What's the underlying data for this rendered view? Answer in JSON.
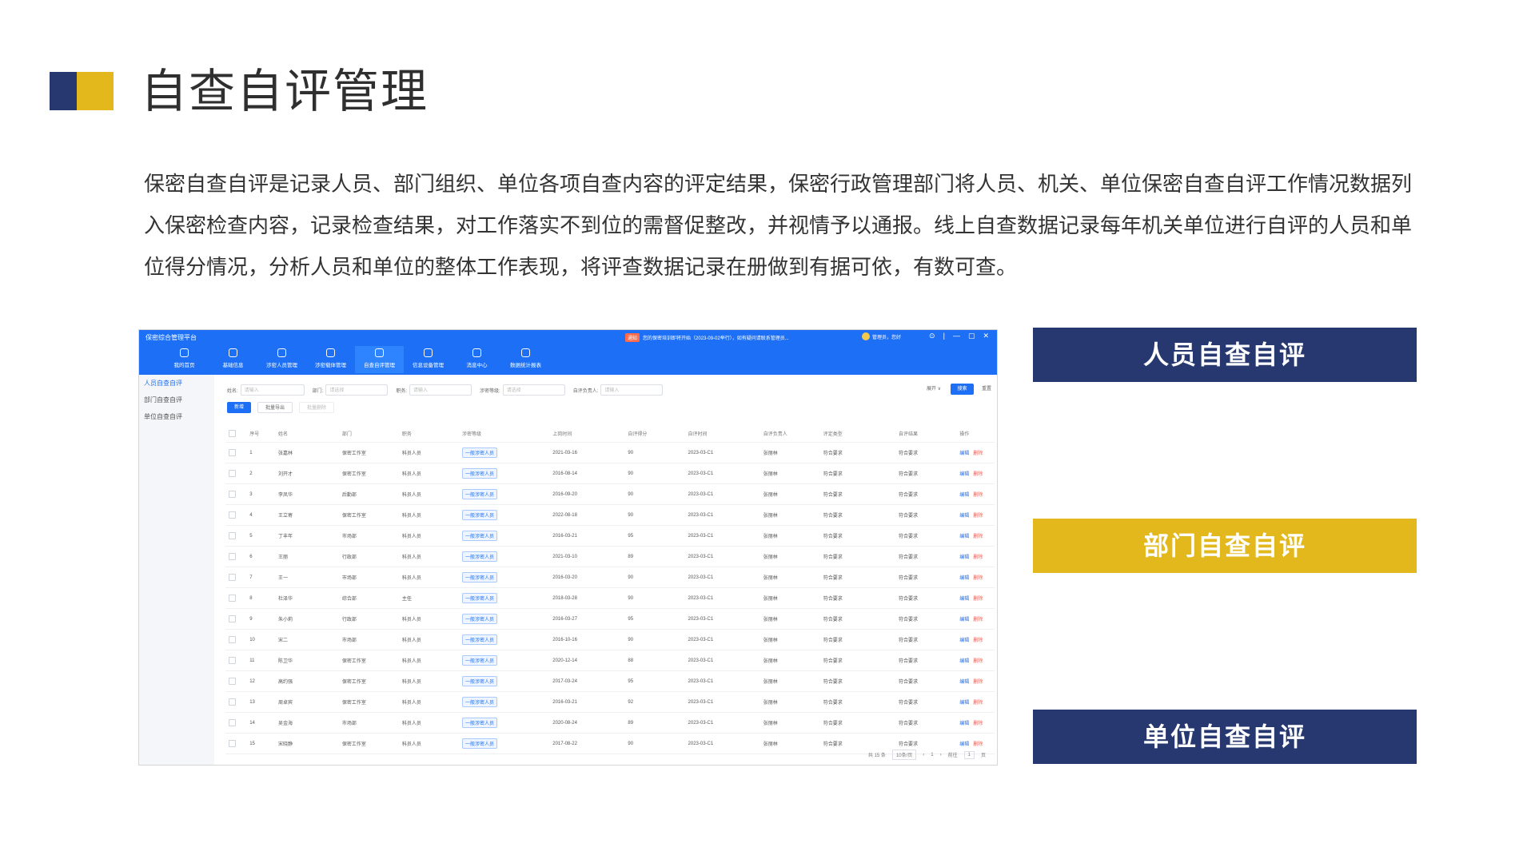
{
  "slide": {
    "title": "自查自评管理",
    "description": "保密自查自评是记录人员、部门组织、单位各项自查内容的评定结果，保密行政管理部门将人员、机关、单位保密自查自评工作情况数据列入保密检查内容，记录检查结果，对工作落实不到位的需督促整改，并视情予以通报。线上自查数据记录每年机关单位进行自评的人员和单位得分情况，分析人员和单位的整体工作表现，将评查数据记录在册做到有据可依，有数可查。",
    "colors": {
      "navy": "#26386f",
      "yellow": "#e2b81c",
      "app_blue": "#1d70f5"
    }
  },
  "app": {
    "brand": "保密综合管理平台",
    "notice_tag": "通知",
    "notice_text": "您的保密培训即将开始（2023-09-02举行），如有疑问请联系管理员...",
    "user": "管理员，您好",
    "window_controls": [
      "⊙",
      "|",
      "—",
      "▢",
      "✕"
    ],
    "nav": [
      {
        "label": "我的首页",
        "icon": "monitor-icon"
      },
      {
        "label": "基础信息",
        "icon": "info-icon"
      },
      {
        "label": "涉密人员管理",
        "icon": "person-icon"
      },
      {
        "label": "涉密载体管理",
        "icon": "archive-icon"
      },
      {
        "label": "自查自评管理",
        "icon": "edit-icon"
      },
      {
        "label": "信息设备管理",
        "icon": "device-icon"
      },
      {
        "label": "消息中心",
        "icon": "chat-icon"
      },
      {
        "label": "数据统计报表",
        "icon": "bar-chart-icon"
      }
    ],
    "sidebar": [
      "人员自查自评",
      "部门自查自评",
      "单位自查自评"
    ],
    "filters": [
      {
        "label": "姓名:",
        "placeholder": "请输入"
      },
      {
        "label": "部门:",
        "placeholder": "请选择"
      },
      {
        "label": "职务:",
        "placeholder": "请输入"
      },
      {
        "label": "涉密等级:",
        "placeholder": "请选择"
      },
      {
        "label": "自评负责人:",
        "placeholder": "请输入"
      }
    ],
    "expand_label": "展开 ∨",
    "search_label": "搜索",
    "reset_label": "重置",
    "actions": [
      "新增",
      "批量导出",
      "批量删除"
    ],
    "columns": [
      "序号",
      "姓名",
      "部门",
      "职务",
      "涉密等级",
      "上岗时间",
      "自评得分",
      "自评时间",
      "自评负责人",
      "评定类型",
      "自评结果",
      "操作"
    ],
    "rows": [
      [
        "1",
        "张嘉林",
        "保密工作室",
        "科员人员",
        "一般涉密人员",
        "2021-03-16",
        "90",
        "2023-03-C1",
        "张丽林",
        "符合要求",
        "符合要求"
      ],
      [
        "2",
        "刘开才",
        "保密工作室",
        "科员人员",
        "一般涉密人员",
        "2016-08-14",
        "90",
        "2023-03-C1",
        "张丽林",
        "符合要求",
        "符合要求"
      ],
      [
        "3",
        "李凤华",
        "后勤部",
        "科员人员",
        "一般涉密人员",
        "2016-09-20",
        "90",
        "2023-03-C1",
        "张丽林",
        "符合要求",
        "符合要求"
      ],
      [
        "4",
        "王立寄",
        "保密工作室",
        "科员人员",
        "一般涉密人员",
        "2022-08-18",
        "90",
        "2023-03-C1",
        "张丽林",
        "符合要求",
        "符合要求"
      ],
      [
        "5",
        "丁丰年",
        "市场部",
        "科员人员",
        "一般涉密人员",
        "2016-03-21",
        "95",
        "2023-03-C1",
        "张丽林",
        "符合要求",
        "符合要求"
      ],
      [
        "6",
        "王丽",
        "行政部",
        "科员人员",
        "一般涉密人员",
        "2021-03-10",
        "89",
        "2023-03-C1",
        "张丽林",
        "符合要求",
        "符合要求"
      ],
      [
        "7",
        "王一",
        "市场部",
        "科员人员",
        "一般涉密人员",
        "2016-03-20",
        "90",
        "2023-03-C1",
        "张丽林",
        "符合要求",
        "符合要求"
      ],
      [
        "8",
        "杜泽华",
        "综合部",
        "主任",
        "一般涉密人员",
        "2018-03-28",
        "90",
        "2023-03-C1",
        "张丽林",
        "符合要求",
        "符合要求"
      ],
      [
        "9",
        "朱小莉",
        "行政部",
        "科员人员",
        "一般涉密人员",
        "2016-03-27",
        "95",
        "2023-03-C1",
        "张丽林",
        "符合要求",
        "符合要求"
      ],
      [
        "10",
        "宋二",
        "市场部",
        "科员人员",
        "一般涉密人员",
        "2016-10-16",
        "90",
        "2023-03-C1",
        "张丽林",
        "符合要求",
        "符合要求"
      ],
      [
        "11",
        "陈卫华",
        "保密工作室",
        "科员人员",
        "一般涉密人员",
        "2020-12-14",
        "88",
        "2023-03-C1",
        "张丽林",
        "符合要求",
        "符合要求"
      ],
      [
        "12",
        "高约强",
        "保密工作室",
        "科员人员",
        "一般涉密人员",
        "2017-03-24",
        "95",
        "2023-03-C1",
        "张丽林",
        "符合要求",
        "符合要求"
      ],
      [
        "13",
        "周卓宾",
        "保密工作室",
        "科员人员",
        "一般涉密人员",
        "2016-03-21",
        "92",
        "2023-03-C1",
        "张丽林",
        "符合要求",
        "符合要求"
      ],
      [
        "14",
        "吴金海",
        "市场部",
        "科员人员",
        "一般涉密人员",
        "2020-08-24",
        "89",
        "2023-03-C1",
        "张丽林",
        "符合要求",
        "符合要求"
      ],
      [
        "15",
        "宋晓静",
        "保密工作室",
        "科员人员",
        "一般涉密人员",
        "2017-08-22",
        "90",
        "2023-03-C1",
        "张丽林",
        "符合要求",
        "符合要求"
      ]
    ],
    "row_ops": {
      "edit": "编辑",
      "delete": "删除"
    },
    "pager": {
      "total": "共 15 条",
      "page_size": "10条/页",
      "goto_label": "前往",
      "page": "1",
      "page_unit": "页"
    }
  },
  "categories": [
    "人员自查自评",
    "部门自查自评",
    "单位自查自评"
  ]
}
